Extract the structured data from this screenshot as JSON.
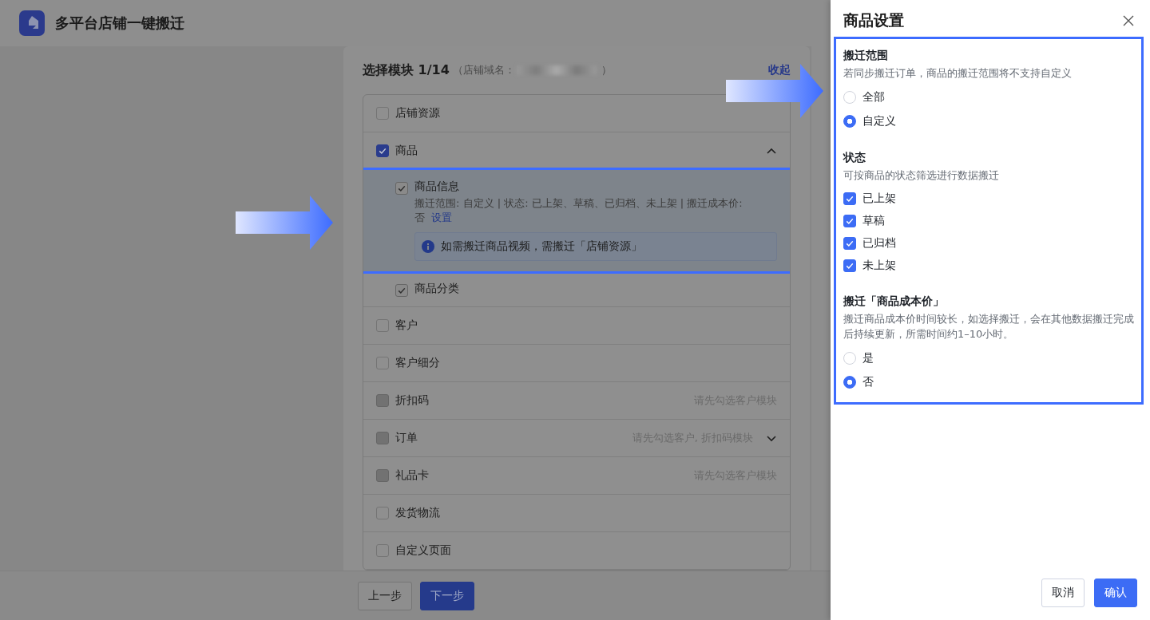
{
  "app": {
    "title": "多平台店铺一键搬迁"
  },
  "step": {
    "title": "选择模块 1/14",
    "domain_open": "（店铺域名：",
    "domain_close": "）",
    "collapse": "收起"
  },
  "modules": [
    {
      "label": "店铺资源",
      "checked": false,
      "disabled": false
    },
    {
      "label": "商品",
      "checked": true,
      "disabled": false,
      "expanded": true,
      "children": [
        {
          "label": "商品信息",
          "checked": true,
          "disabled": true,
          "details": "搬迁范围: 自定义 | 状态: 已上架、草稿、已归档、未上架 | 搬迁成本价: 否",
          "link": "设置",
          "notice": "如需搬迁商品视频，需搬迁「店铺资源」"
        },
        {
          "label": "商品分类",
          "checked": true,
          "disabled": true
        }
      ]
    },
    {
      "label": "客户",
      "checked": false,
      "disabled": false
    },
    {
      "label": "客户细分",
      "checked": false,
      "disabled": false
    },
    {
      "label": "折扣码",
      "checked": false,
      "disabled": true,
      "hint": "请先勾选客户模块"
    },
    {
      "label": "订单",
      "checked": false,
      "disabled": true,
      "hint": "请先勾选客户, 折扣码模块",
      "expanded": false
    },
    {
      "label": "礼品卡",
      "checked": false,
      "disabled": true,
      "hint": "请先勾选客户模块"
    },
    {
      "label": "发货物流",
      "checked": false,
      "disabled": false
    },
    {
      "label": "自定义页面",
      "checked": false,
      "disabled": false
    }
  ],
  "footer": {
    "prev": "上一步",
    "next": "下一步"
  },
  "drawer": {
    "title": "商品设置",
    "sections": [
      {
        "kind": "radio",
        "title": "搬迁范围",
        "description": "若同步搬迁订单，商品的搬迁范围将不支持自定义",
        "options": [
          {
            "label": "全部",
            "selected": false
          },
          {
            "label": "自定义",
            "selected": true
          }
        ]
      },
      {
        "kind": "checkbox",
        "title": "状态",
        "description": "可按商品的状态筛选进行数据搬迁",
        "options": [
          {
            "label": "已上架",
            "checked": true
          },
          {
            "label": "草稿",
            "checked": true
          },
          {
            "label": "已归档",
            "checked": true
          },
          {
            "label": "未上架",
            "checked": true
          }
        ]
      },
      {
        "kind": "radio",
        "title": "搬迁「商品成本价」",
        "description": "搬迁商品成本价时间较长，如选择搬迁，会在其他数据搬迁完成后持续更新，所需时间约1–10小时。",
        "options": [
          {
            "label": "是",
            "selected": false
          },
          {
            "label": "否",
            "selected": true
          }
        ]
      }
    ],
    "cancel": "取消",
    "confirm": "确认"
  }
}
